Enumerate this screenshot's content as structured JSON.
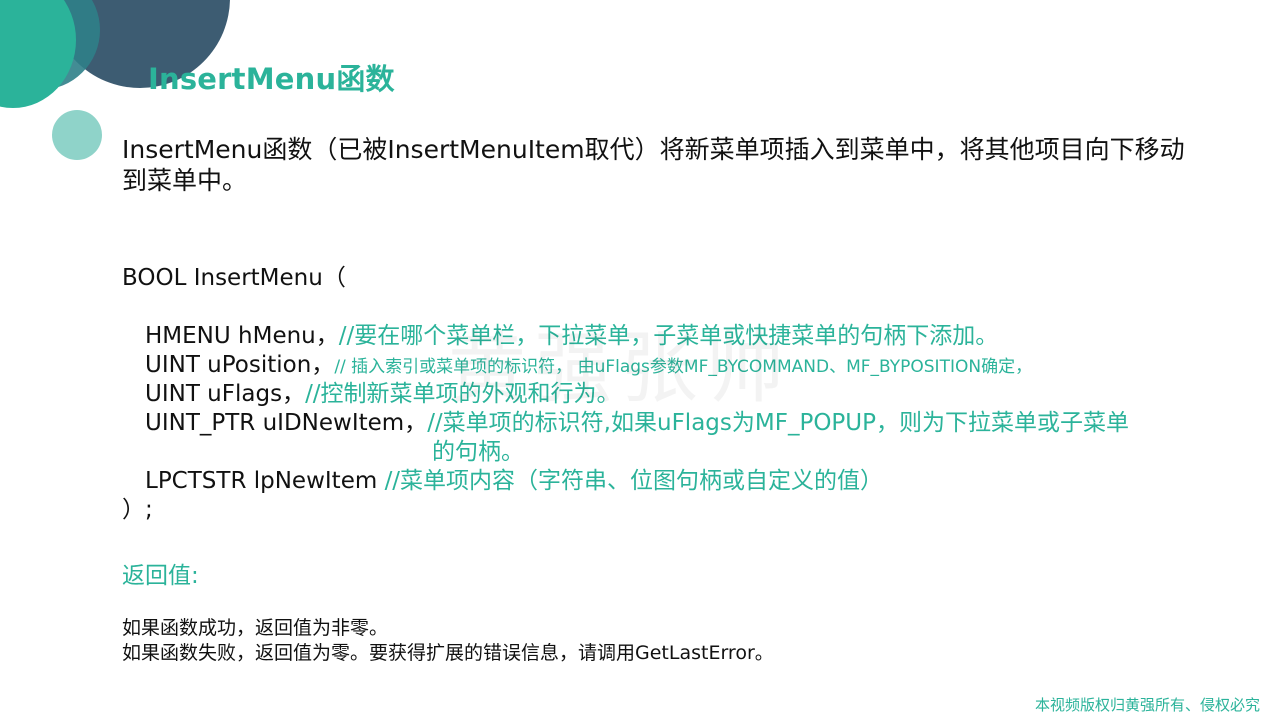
{
  "title": "InsertMenu函数",
  "intro": "InsertMenu函数（已被InsertMenuItem取代）将新菜单项插入到菜单中，将其他项目向下移动到菜单中。",
  "code": {
    "header": "BOOL  InsertMenu（",
    "params": [
      {
        "text": "HMENU hMenu，",
        "comment": "//要在哪个菜单栏，下拉菜单，子菜单或快捷菜单的句柄下添加。"
      },
      {
        "text": "UINT uPosition，",
        "comment": "// 插入索引或菜单项的标识符，  由uFlags参数MF_BYCOMMAND、MF_BYPOSITION确定，"
      },
      {
        "text": "UINT uFlags，",
        "comment": "//控制新菜单项的外观和行为。"
      },
      {
        "text": "UINT_PTR uIDNewItem，",
        "comment": "//菜单项的标识符,如果uFlags为MF_POPUP，则为下拉菜单或子菜单",
        "comment_cont": "的句柄。"
      },
      {
        "text": "LPCTSTR lpNewItem ",
        "comment": "//菜单项内容（字符串、位图句柄或自定义的值）"
      }
    ],
    "footer": "）;"
  },
  "return_heading": "返回值:",
  "return_lines": [
    "如果函数成功，返回值为非零。",
    "如果函数失败，返回值为零。要获得扩展的错误信息，请调用GetLastError。"
  ],
  "watermark": "黄强张帅",
  "copyright": "本视频版权归黄强所有、侵权必究",
  "colors": {
    "accent": "#2bb39a",
    "dark_circle": "#3d5c72",
    "light_circle": "#8fd3c9"
  }
}
